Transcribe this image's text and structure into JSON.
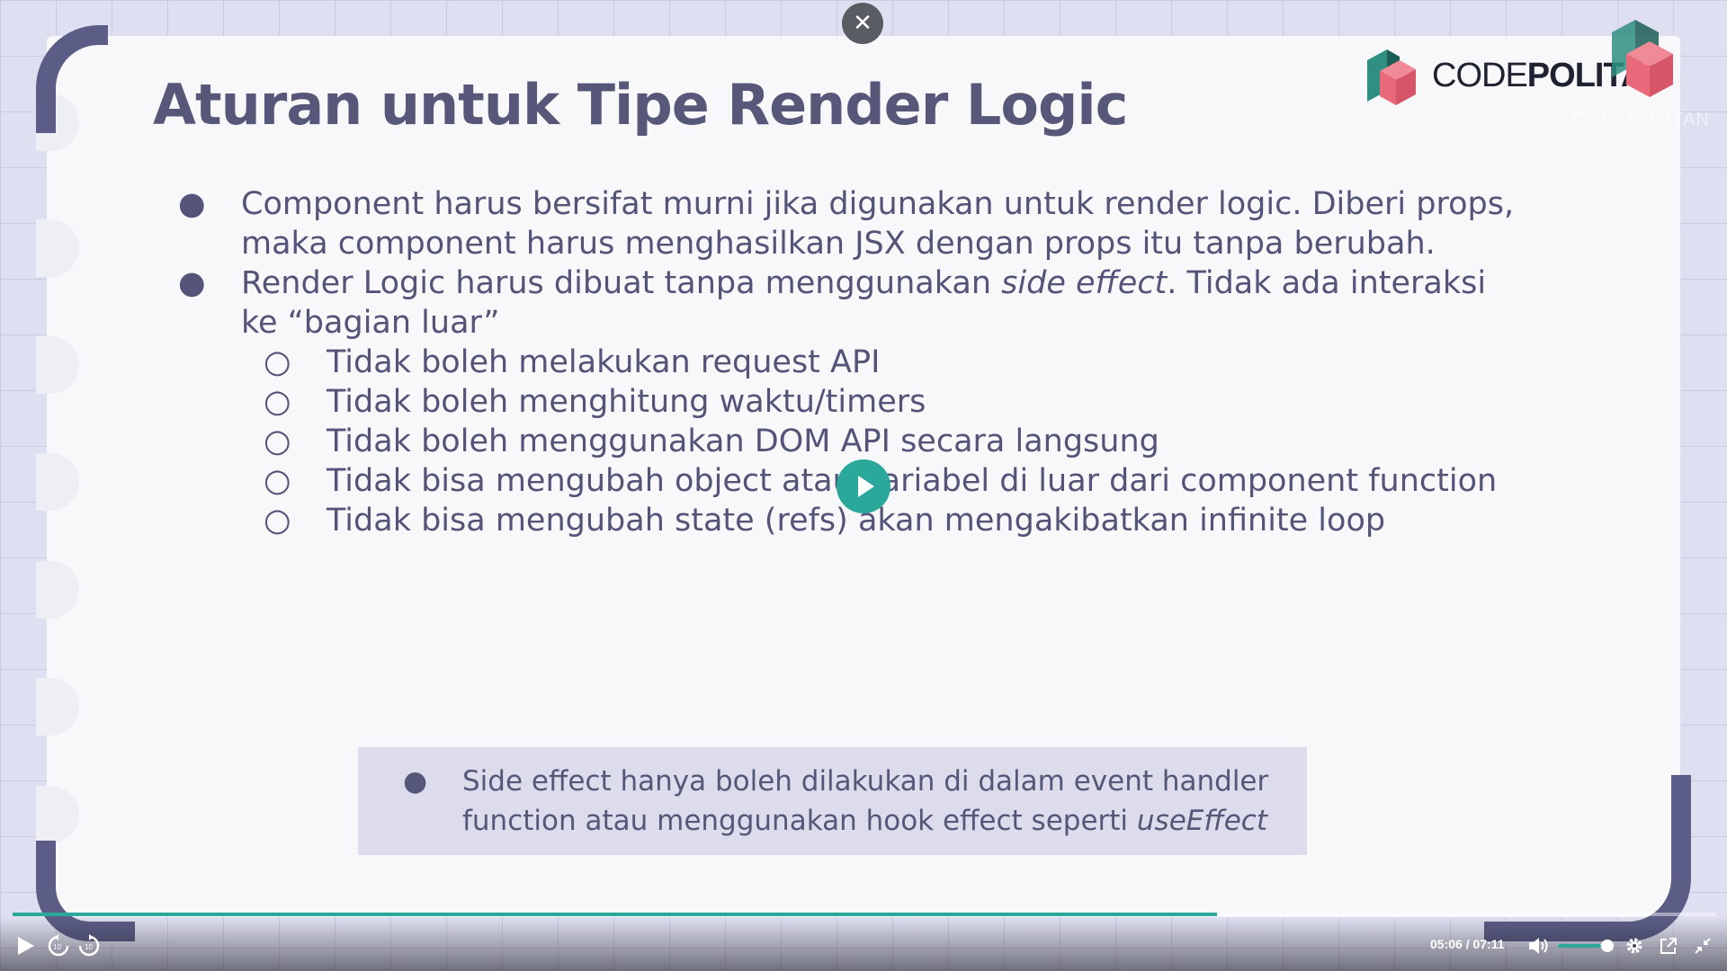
{
  "slide": {
    "title": "Aturan untuk Tipe Render Logic",
    "logo_text_light": "CODE",
    "logo_text_bold": "POLITAN",
    "watermark": "CODEPOLITAN",
    "bullets": [
      {
        "text": "Component harus bersifat murni jika digunakan untuk render logic. Diberi props, maka component harus menghasilkan JSX dengan props itu tanpa berubah."
      },
      {
        "text_before": "Render Logic harus dibuat tanpa menggunakan ",
        "text_italic": "side effect",
        "text_after": ". Tidak ada interaksi ke “bagian luar”",
        "sub_items": [
          "Tidak boleh melakukan request API",
          "Tidak boleh menghitung waktu/timers",
          "Tidak boleh menggunakan DOM API secara langsung",
          "Tidak bisa mengubah object atau variabel di luar dari component function",
          "Tidak bisa mengubah state (refs) akan mengakibatkan infinite loop"
        ]
      }
    ],
    "callout": {
      "text": "Side effect hanya boleh dilakukan di dalam event handler function atau menggunakan hook effect seperti ",
      "text_italic": "useEffect"
    }
  },
  "player": {
    "close_icon": "close-icon",
    "play_icon": "play-icon",
    "current_time": "05:06",
    "separator": "/",
    "duration": "07:11",
    "progress": 0.707,
    "volume": 0.85,
    "accent_color": "#2aa89a"
  }
}
